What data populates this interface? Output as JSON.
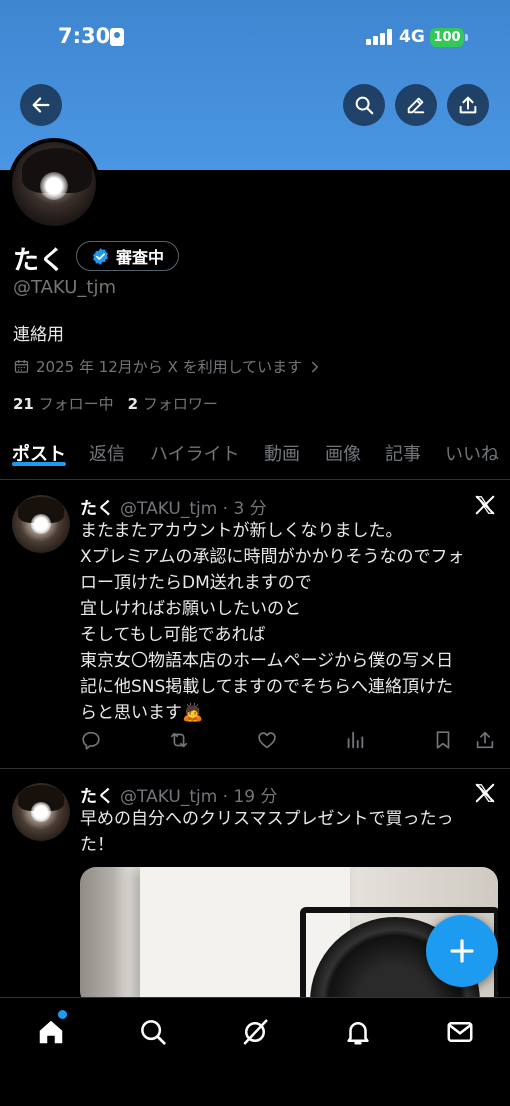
{
  "status_bar": {
    "time": "7:30",
    "network": "4G",
    "battery": "100"
  },
  "profile": {
    "name": "たく",
    "badge_label": "審査中",
    "handle": "@TAKU_tjm",
    "bio": "連絡用",
    "joined": "2025 年 12月から X を利用しています",
    "following_count": "21",
    "following_label": "フォロー中",
    "followers_count": "2",
    "followers_label": "フォロワー"
  },
  "tabs": [
    {
      "label": "ポスト",
      "active": true
    },
    {
      "label": "返信"
    },
    {
      "label": "ハイライト"
    },
    {
      "label": "動画"
    },
    {
      "label": "画像"
    },
    {
      "label": "記事"
    },
    {
      "label": "いいね"
    }
  ],
  "posts": [
    {
      "author": "たく",
      "meta": "@TAKU_tjm · 3 分",
      "lines": [
        "またまたアカウントが新しくなりました。",
        "Xプレミアムの承認に時間がかかりそうなのでフォ",
        "ロー頂けたらDM送れますので",
        "宜しければお願いしたいのと",
        "そしてもし可能であれば",
        "東京女〇物語本店のホームページから僕の写メ日",
        "記に他SNS掲載してますのでそちらへ連絡頂けた",
        "らと思います🙇"
      ]
    },
    {
      "author": "たく",
      "meta": "@TAKU_tjm · 19 分",
      "lines": [
        "早めの自分へのクリスマスプレゼントで買ったっ",
        "た！"
      ]
    }
  ],
  "icons": {
    "back": "back-arrow-icon",
    "search": "search-icon",
    "edit": "pencil-icon",
    "share": "share-icon",
    "verified": "verified-check-icon",
    "calendar": "calendar-icon",
    "x_logo": "x-logo-icon",
    "reply": "reply-icon",
    "repost": "repost-icon",
    "like": "heart-icon",
    "views": "views-icon",
    "bookmark": "bookmark-icon",
    "compose": "plus-icon",
    "home": "home-icon",
    "explore": "search-icon",
    "grok": "grok-icon",
    "notifications": "bell-icon",
    "messages": "mail-icon"
  },
  "colors": {
    "banner": "#4a96e4",
    "accent": "#1d9bf0",
    "battery": "#34c759",
    "muted_text": "#71767b"
  }
}
